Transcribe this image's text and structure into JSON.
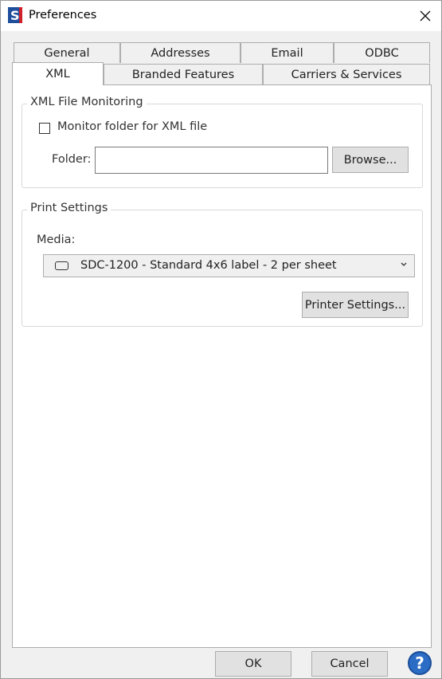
{
  "window": {
    "title": "Preferences",
    "logo_letter": "S"
  },
  "tabs": {
    "row_back": [
      {
        "label": "General"
      },
      {
        "label": "Addresses"
      },
      {
        "label": "Email"
      },
      {
        "label": "ODBC"
      }
    ],
    "row_front": [
      {
        "label": "XML",
        "active": true
      },
      {
        "label": "Branded Features"
      },
      {
        "label": "Carriers & Services"
      }
    ]
  },
  "xml_monitoring": {
    "title": "XML File Monitoring",
    "monitor_checkbox_label": "Monitor folder for XML file",
    "monitor_checked": false,
    "folder_label": "Folder:",
    "folder_value": "",
    "browse_button": "Browse..."
  },
  "print_settings": {
    "title": "Print Settings",
    "media_label": "Media:",
    "media_selected": "SDC-1200 - Standard 4x6 label - 2 per sheet",
    "printer_settings_button": "Printer Settings..."
  },
  "footer": {
    "ok_button": "OK",
    "cancel_button": "Cancel",
    "help_glyph": "?"
  },
  "colors": {
    "logo_blue": "#1f4e9c",
    "logo_red": "#d0202a",
    "help_blue": "#2b6cc4"
  }
}
